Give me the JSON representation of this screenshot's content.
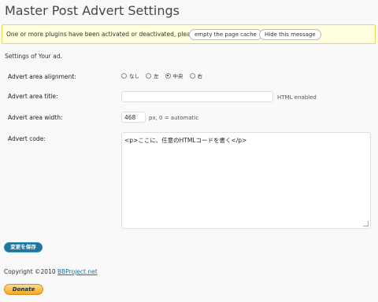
{
  "page": {
    "title": "Master Post Advert Settings"
  },
  "notice": {
    "message": "One or more plugins have been activated or deactivated, please",
    "empty_cache_label": "empty the page cache",
    "hide_label": "Hide this message"
  },
  "section": {
    "intro": "Settings of Your ad."
  },
  "alignment": {
    "label": "Advert area alignment:",
    "options": [
      "なし",
      "左",
      "中央",
      "右"
    ],
    "selected": "中央"
  },
  "area_title": {
    "label": "Advert area title:",
    "value": "",
    "hint": "HTML enabled"
  },
  "area_width": {
    "label": "Advert area width:",
    "value": "468",
    "hint": "px, 0 = automatic"
  },
  "advert_code": {
    "label": "Advert code:",
    "value": "<p>ここに、任意のHTMLコードを書く</p>"
  },
  "save_button": {
    "label": "変更を保存"
  },
  "footer": {
    "copyright_prefix": "Copyright ©2010 ",
    "link_text": "BBProject.net"
  },
  "donate": {
    "label": "Donate"
  }
}
